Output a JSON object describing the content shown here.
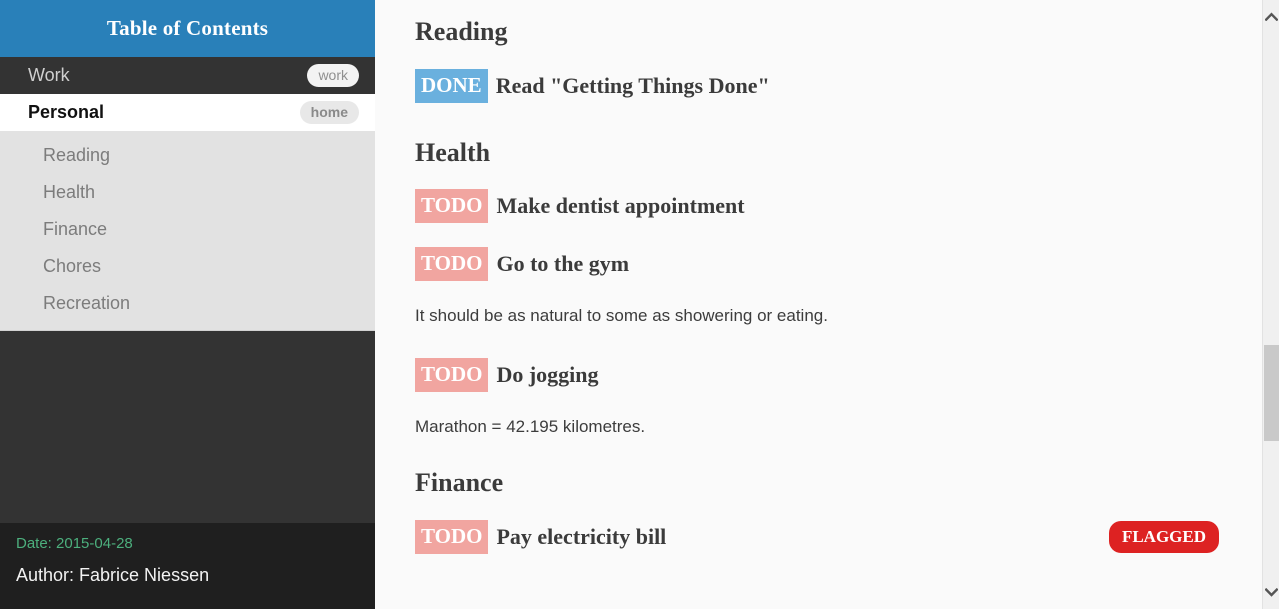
{
  "sidebar": {
    "header_title": "Table of Contents",
    "top_items": [
      {
        "label": "Work",
        "tag": "work",
        "active": false
      },
      {
        "label": "Personal",
        "tag": "home",
        "active": true
      }
    ],
    "sub_items": [
      {
        "label": "Reading"
      },
      {
        "label": "Health"
      },
      {
        "label": "Finance"
      },
      {
        "label": "Chores"
      },
      {
        "label": "Recreation"
      }
    ],
    "footer": {
      "date": "Date: 2015-04-28",
      "author": "Author: Fabrice Niessen"
    }
  },
  "content": {
    "sections": [
      {
        "heading": "Reading",
        "items": [
          {
            "kind": "task",
            "keyword": "DONE",
            "title": "Read \"Getting Things Done\""
          }
        ]
      },
      {
        "heading": "Health",
        "items": [
          {
            "kind": "task",
            "keyword": "TODO",
            "title": "Make dentist appointment"
          },
          {
            "kind": "task",
            "keyword": "TODO",
            "title": "Go to the gym"
          },
          {
            "kind": "paragraph",
            "text": "It should be as natural to some as showering or eating."
          },
          {
            "kind": "task",
            "keyword": "TODO",
            "title": "Do jogging"
          },
          {
            "kind": "paragraph",
            "text": "Marathon = 42.195 kilometres."
          }
        ]
      },
      {
        "heading": "Finance",
        "items": [
          {
            "kind": "task",
            "keyword": "TODO",
            "title": "Pay electricity bill",
            "flag": "FLAGGED"
          }
        ]
      }
    ]
  },
  "scrollbar": {
    "up_icon": "chevron-up-icon",
    "down_icon": "chevron-down-icon"
  },
  "colors": {
    "header_blue": "#2980b9",
    "sidebar_dark": "#333333",
    "sidebar_footer": "#1f1f1f",
    "submenu_gray": "#e2e2e2",
    "done_badge": "#6ab0de",
    "todo_badge": "#f1a5a0",
    "flagged_badge": "#dd2222",
    "date_green": "#4caf7d",
    "content_bg": "#fafafa"
  }
}
